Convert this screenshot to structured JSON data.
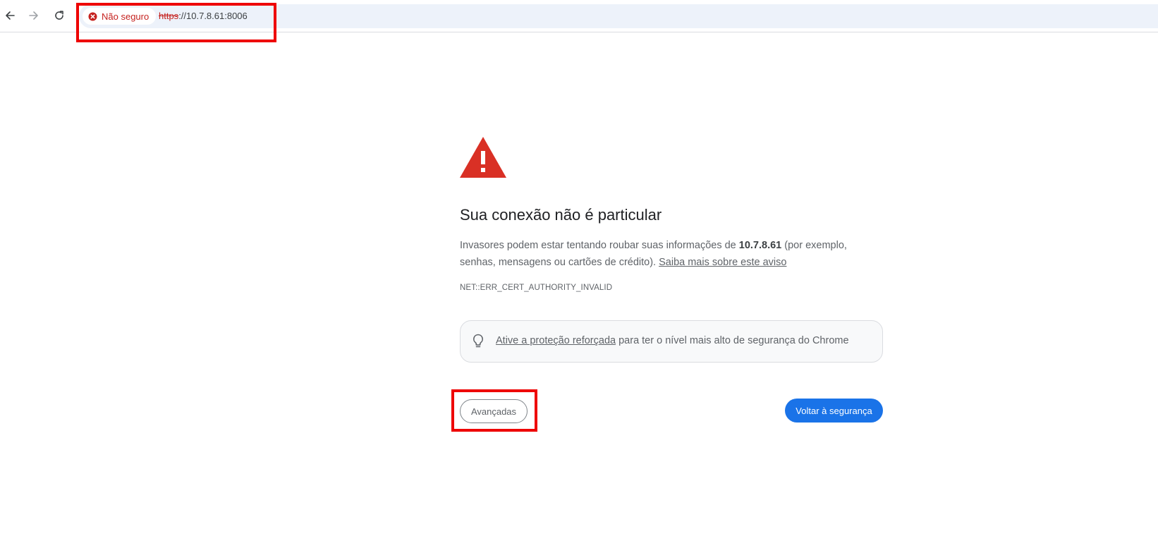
{
  "browser": {
    "security_chip": {
      "label": "Não seguro",
      "color": "#c5221f",
      "icon": "error-circle-icon"
    },
    "url": {
      "scheme": "https",
      "rest": "://10.7.8.61:8006"
    },
    "nav": {
      "back_icon": "arrow-left-icon",
      "forward_icon": "arrow-right-icon",
      "reload_icon": "reload-icon"
    }
  },
  "interstitial": {
    "warning_icon": "warning-triangle-icon",
    "heading": "Sua conexão não é particular",
    "explanation": {
      "part1": "Invasores podem estar tentando roubar suas informações de ",
      "host": "10.7.8.61",
      "part2": " (por exemplo, senhas, mensagens ou cartões de crédito). ",
      "learn_more": "Saiba mais sobre este aviso"
    },
    "error_code": "NET::ERR_CERT_AUTHORITY_INVALID",
    "enhanced_protection": {
      "icon": "lightbulb-icon",
      "link": "Ative a proteção reforçada",
      "text": " para ter o nível mais alto de segurança do Chrome"
    },
    "buttons": {
      "advanced": "Avançadas",
      "back_to_safety": "Voltar à segurança"
    }
  },
  "colors": {
    "danger": "#c5221f",
    "primary": "#1a73e8",
    "warning_icon": "#d93025",
    "highlight_box": "#ee0000"
  }
}
